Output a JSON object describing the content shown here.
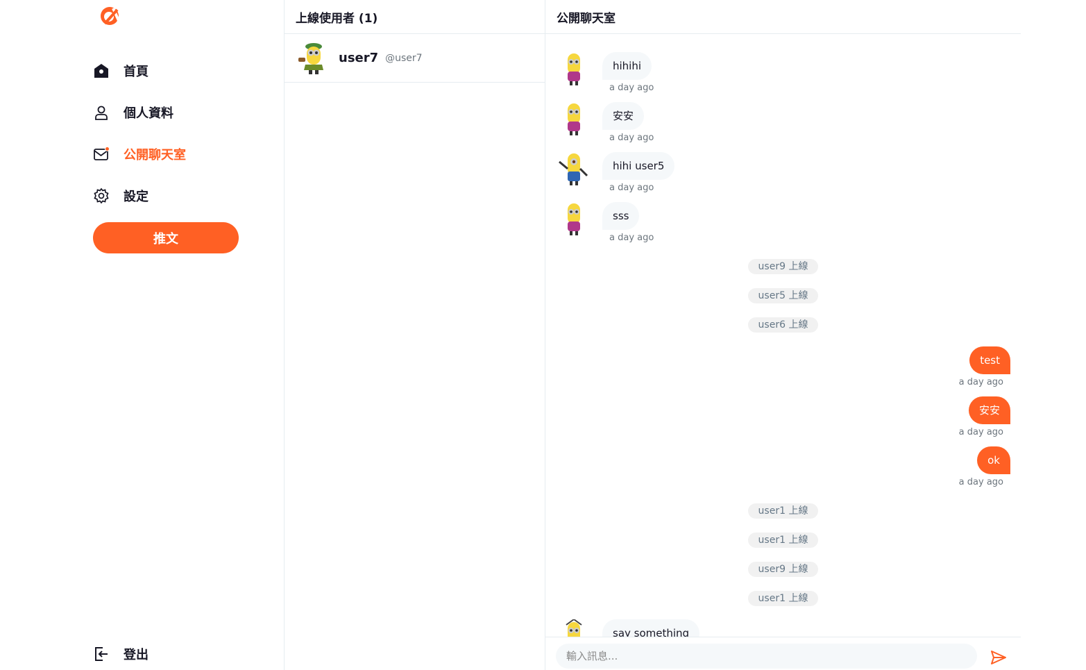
{
  "nav": {
    "items": [
      {
        "label": "首頁",
        "icon": "home-icon"
      },
      {
        "label": "個人資料",
        "icon": "user-icon"
      },
      {
        "label": "公開聊天室",
        "icon": "mail-icon",
        "active": true
      },
      {
        "label": "設定",
        "icon": "gear-icon"
      }
    ],
    "tweet_label": "推文",
    "logout_label": "登出"
  },
  "online": {
    "title": "上線使用者 (1)",
    "users": [
      {
        "name": "user7",
        "account": "@user7"
      }
    ]
  },
  "chat": {
    "title": "公開聊天室",
    "messages": [
      {
        "kind": "in",
        "text": "hihihi",
        "time": "a day ago"
      },
      {
        "kind": "in",
        "text": "安安",
        "time": "a day ago"
      },
      {
        "kind": "in",
        "text": "hihi user5",
        "time": "a day ago"
      },
      {
        "kind": "in",
        "text": "sss",
        "time": "a day ago"
      },
      {
        "kind": "sys",
        "text": "user9 上線"
      },
      {
        "kind": "sys",
        "text": "user5 上線"
      },
      {
        "kind": "sys",
        "text": "user6 上線"
      },
      {
        "kind": "out",
        "text": "test",
        "time": "a day ago"
      },
      {
        "kind": "out",
        "text": "安安",
        "time": "a day ago"
      },
      {
        "kind": "out",
        "text": "ok",
        "time": "a day ago"
      },
      {
        "kind": "sys",
        "text": "user1 上線"
      },
      {
        "kind": "sys",
        "text": "user1 上線"
      },
      {
        "kind": "sys",
        "text": "user9 上線"
      },
      {
        "kind": "sys",
        "text": "user1 上線"
      },
      {
        "kind": "in",
        "text": "say something",
        "time": ""
      }
    ],
    "input_placeholder": "輸入訊息..."
  },
  "colors": {
    "accent": "#ff6024",
    "bubble_in": "#f5f8fa",
    "border": "#e6ecf0",
    "muted": "#6c757d"
  }
}
